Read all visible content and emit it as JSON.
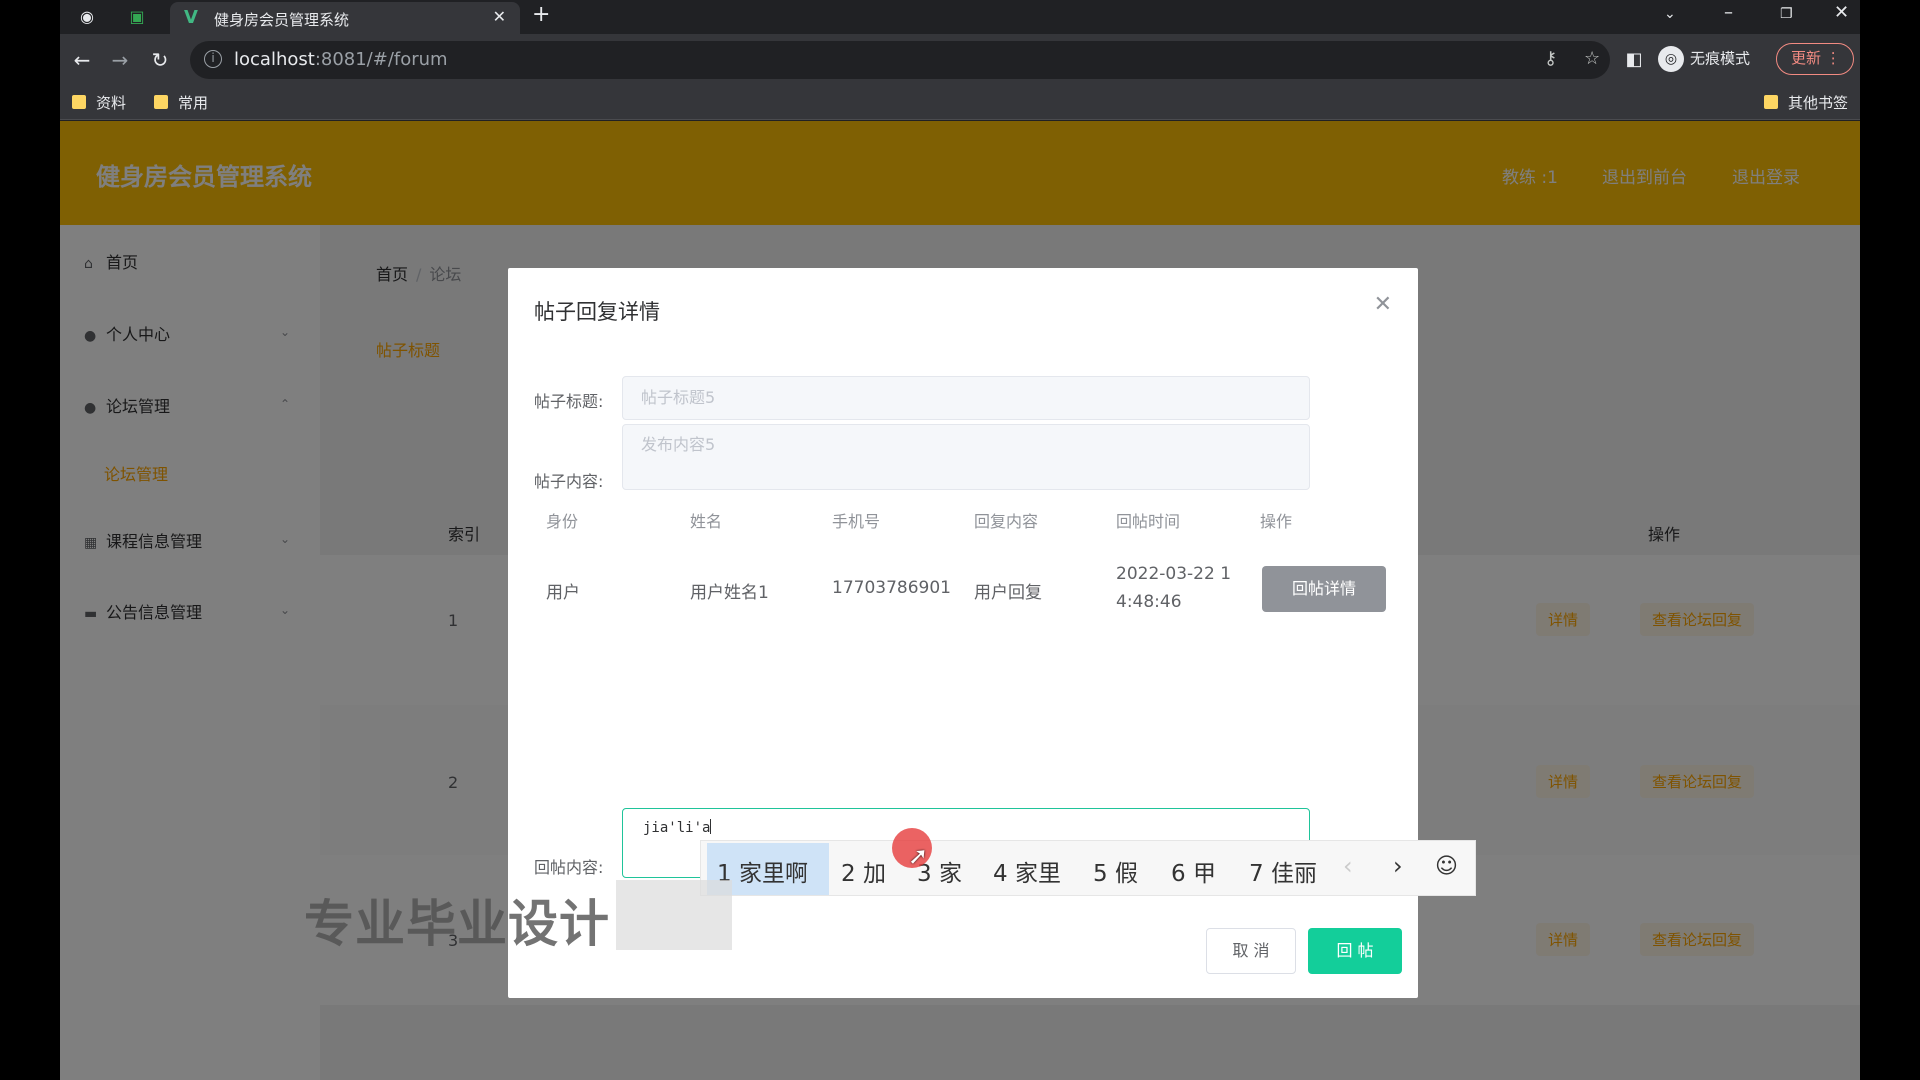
{
  "browser": {
    "tab_title": "健身房会员管理系统",
    "url_host": "localhost",
    "url_rest": ":8081/#/forum",
    "incognito_label": "无痕模式",
    "update_label": "更新",
    "bookmarks": [
      "资料",
      "常用"
    ],
    "other_bookmarks": "其他书签"
  },
  "app": {
    "title": "健身房会员管理系统",
    "header_links": [
      "教练 :1",
      "退出到前台",
      "退出登录"
    ],
    "sidebar": {
      "items": [
        "首页",
        "个人中心",
        "论坛管理",
        "课程信息管理",
        "公告信息管理"
      ],
      "sub_item": "论坛管理"
    },
    "breadcrumb": {
      "home": "首页",
      "current": "论坛"
    },
    "search_label": "帖子标题",
    "table": {
      "header_index": "索引",
      "header_action": "操作",
      "rows": [
        "1",
        "2",
        "3"
      ],
      "action_detail": "详情",
      "action_view": "查看论坛回复"
    }
  },
  "modal": {
    "title": "帖子回复详情",
    "post_title_label": "帖子标题:",
    "post_title_value": "帖子标题5",
    "post_content_label": "帖子内容:",
    "post_content_value": "发布内容5",
    "grid": {
      "headers": [
        "身份",
        "姓名",
        "手机号",
        "回复内容",
        "回帖时间",
        "操作"
      ],
      "row": {
        "identity": "用户",
        "name": "用户姓名1",
        "phone": "17703786901",
        "reply": "用户回复",
        "time_line1": "2022-03-22 1",
        "time_line2": "4:48:46",
        "action": "回帖详情"
      }
    },
    "reply_label": "回帖内容:",
    "reply_value": "jia'li'a",
    "cancel_label": "取 消",
    "submit_label": "回 帖"
  },
  "ime": {
    "candidates": [
      "1 家里啊",
      "2 加",
      "3 家",
      "4 家里",
      "5 假",
      "6 甲",
      "7 佳丽"
    ]
  },
  "watermark": "专业毕业设计",
  "colors": {
    "header": "#ffc107",
    "accent": "#ffa600",
    "primary": "#13ce9a"
  }
}
